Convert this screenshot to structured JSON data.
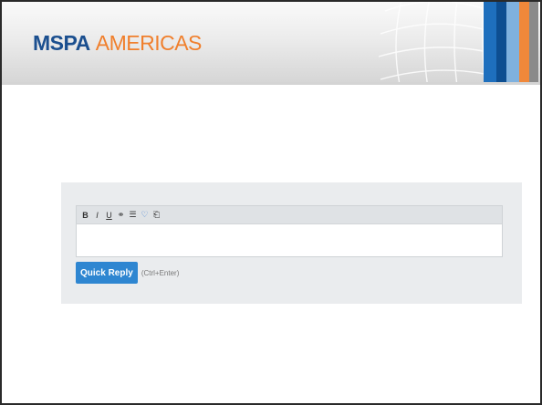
{
  "banner": {
    "logo_primary": "MSPA",
    "logo_secondary": "AMERICAS",
    "colors": {
      "logo_primary": "#1b4f8f",
      "logo_secondary": "#f07f2c",
      "stripes": [
        "#1e6fbd",
        "#0d4e91",
        "#7fb1de",
        "#f0883a",
        "#8a8a8a"
      ]
    }
  },
  "editor": {
    "toolbar": [
      {
        "name": "bold-button",
        "glyph": "B",
        "icon": "bold-icon"
      },
      {
        "name": "italic-button",
        "glyph": "I",
        "icon": "italic-icon"
      },
      {
        "name": "underline-button",
        "glyph": "U",
        "icon": "underline-icon"
      },
      {
        "name": "link-button",
        "glyph": "⚭",
        "icon": "link-icon"
      },
      {
        "name": "list-button",
        "glyph": "☰",
        "icon": "list-icon"
      },
      {
        "name": "emoticon-button",
        "glyph": "♡",
        "icon": "emoticon-icon"
      },
      {
        "name": "attachment-button",
        "glyph": "⎗",
        "icon": "attachment-icon"
      }
    ],
    "content": ""
  },
  "reply": {
    "button_label": "Quick Reply",
    "shortcut_hint": "(Ctrl+Enter)",
    "button_color": "#2e86d1"
  }
}
